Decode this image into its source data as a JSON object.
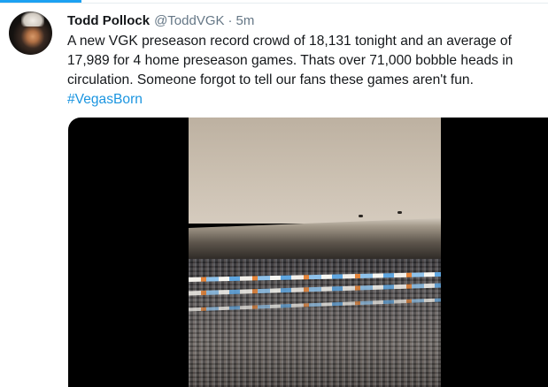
{
  "tweet": {
    "author": {
      "display_name": "Todd Pollock",
      "handle": "@ToddVGK"
    },
    "separator": "·",
    "timestamp": "5m",
    "text": "A new VGK preseason record crowd of 18,131 tonight and an average of 17,989 for 4 home preseason games. Thats over 71,000 bobble heads in circulation. Someone forgot to tell our fans these games aren't fun.",
    "hashtag": "#VegasBorn"
  },
  "colors": {
    "accent": "#1da1f2",
    "link": "#1b95e0",
    "text": "#14171a",
    "secondary_text": "#657786"
  }
}
